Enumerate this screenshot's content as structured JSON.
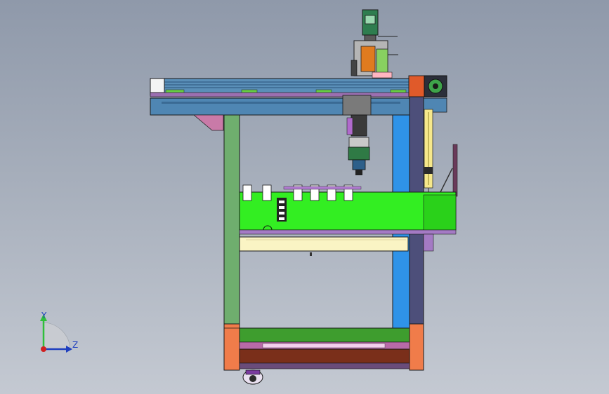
{
  "viewport": {
    "background_top": "#8f99aa",
    "background_bottom": "#c4c9d2"
  },
  "model": {
    "description_icon": "machine-assembly-3d-model"
  },
  "triad": {
    "y_label": "Y",
    "z_label": "Z",
    "y_color": "#2fbf3a",
    "z_color": "#1f3fbf",
    "x_color": "#d02020"
  }
}
